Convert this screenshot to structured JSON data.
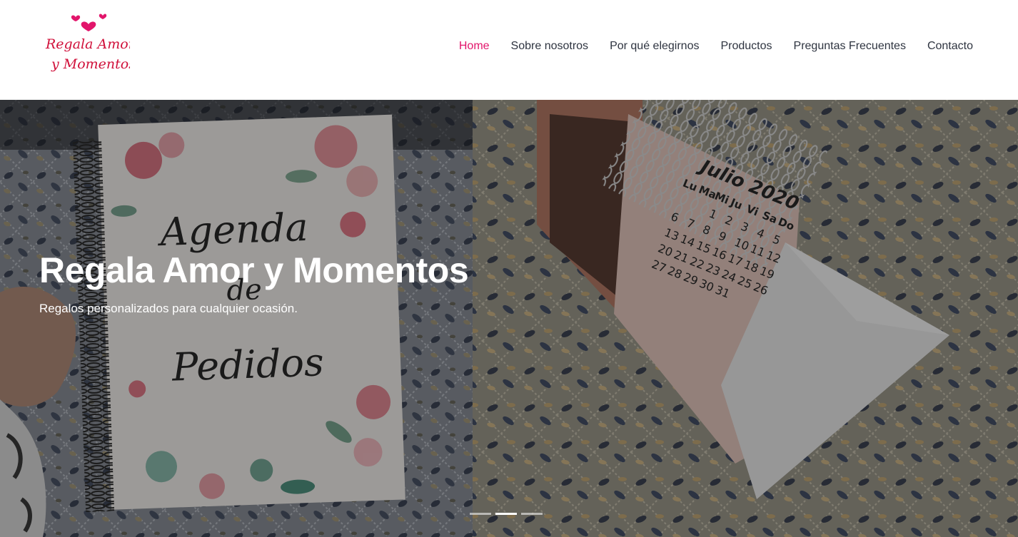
{
  "brand": {
    "logo_line1": "Regala Amor",
    "logo_line2": "y Momentos",
    "accent": "#e2156b"
  },
  "nav": {
    "items": [
      {
        "label": "Home",
        "active": true
      },
      {
        "label": "Sobre nosotros",
        "active": false
      },
      {
        "label": "Por qué elegirnos",
        "active": false
      },
      {
        "label": "Productos",
        "active": false
      },
      {
        "label": "Preguntas Frecuentes",
        "active": false
      },
      {
        "label": "Contacto",
        "active": false
      }
    ]
  },
  "hero": {
    "title": "Regala Amor y Momentos",
    "subtitle": "Regalos personalizados para cualquier ocasión.",
    "slides": 3,
    "active_slide": 2,
    "photo_text": {
      "agenda_line1": "Agenda",
      "agenda_line2": "de",
      "agenda_line3": "Pedidos",
      "calendar_month": "Julio 2020",
      "calendar_days": [
        "Lu",
        "Ma",
        "Mi",
        "Ju",
        "Vi",
        "Sa",
        "Do"
      ],
      "calendar_numbers": [
        [
          "6",
          "13",
          "20",
          "27"
        ],
        [
          "7",
          "14",
          "21",
          "28"
        ],
        [
          "1",
          "8",
          "15",
          "22",
          "29"
        ],
        [
          "2",
          "9",
          "16",
          "23",
          "30"
        ],
        [
          "3",
          "10",
          "17",
          "24",
          "31"
        ],
        [
          "4",
          "11",
          "18",
          "25"
        ],
        [
          "5",
          "12",
          "19",
          "26"
        ]
      ]
    }
  }
}
